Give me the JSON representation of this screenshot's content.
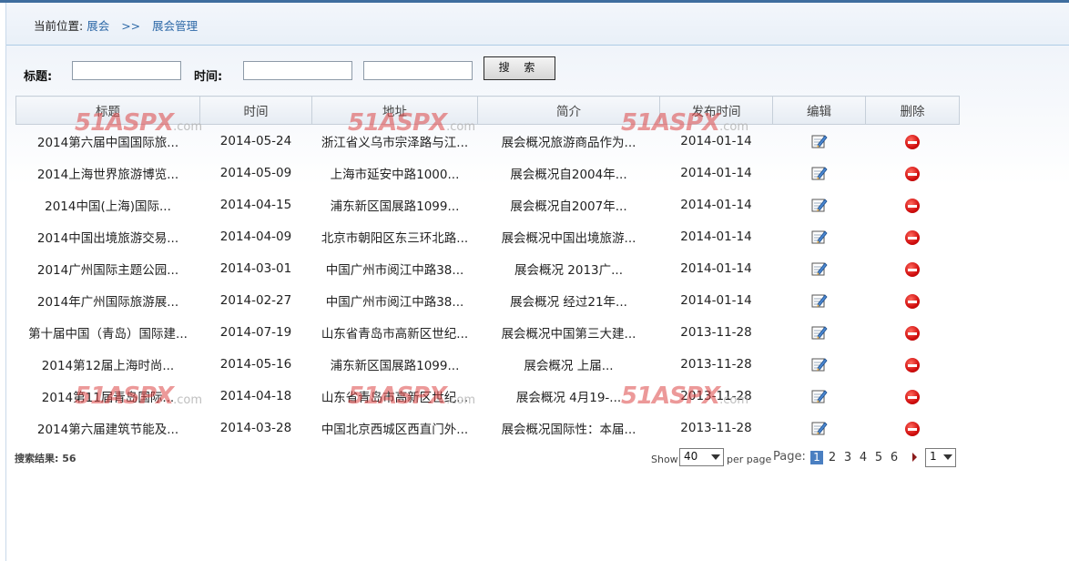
{
  "breadcrumb": {
    "prefix": "当前位置:",
    "link1": "展会",
    "sep": ">>",
    "link2": "展会管理"
  },
  "search": {
    "title_label": "标题:",
    "title_value": "",
    "time_label": "时间:",
    "time_from": "",
    "time_to": "",
    "button_label": "搜 索"
  },
  "table": {
    "headers": [
      "标题",
      "时间",
      "地址",
      "简介",
      "发布时间",
      "编辑",
      "删除"
    ],
    "rows": [
      [
        "2014第六届中国国际旅...",
        "2014-05-24",
        "浙江省义乌市宗泽路与江...",
        "展会概况旅游商品作为...",
        "2014-01-14"
      ],
      [
        "2014上海世界旅游博览...",
        "2014-05-09",
        "上海市延安中路1000...",
        "展会概况自2004年...",
        "2014-01-14"
      ],
      [
        "2014中国(上海)国际...",
        "2014-04-15",
        "浦东新区国展路1099...",
        "展会概况自2007年...",
        "2014-01-14"
      ],
      [
        "2014中国出境旅游交易...",
        "2014-04-09",
        "北京市朝阳区东三环北路...",
        "展会概况中国出境旅游...",
        "2014-01-14"
      ],
      [
        "2014广州国际主题公园...",
        "2014-03-01",
        "中国广州市阅江中路38...",
        "展会概况 2013广...",
        "2014-01-14"
      ],
      [
        "2014年广州国际旅游展...",
        "2014-02-27",
        "中国广州市阅江中路38...",
        "展会概况 经过21年...",
        "2014-01-14"
      ],
      [
        "第十届中国（青岛）国际建...",
        "2014-07-19",
        "山东省青岛市高新区世纪...",
        "展会概况中国第三大建...",
        "2013-11-28"
      ],
      [
        "2014第12届上海时尚...",
        "2014-05-16",
        "浦东新区国展路1099...",
        "展会概况 上届...",
        "2013-11-28"
      ],
      [
        "2014第11届青岛国际...",
        "2014-04-18",
        "山东省青岛市高新区世纪...",
        "展会概况 4月19-...",
        "2013-11-28"
      ],
      [
        "2014第六届建筑节能及...",
        "2014-03-28",
        "中国北京西城区西直门外...",
        "展会概况国际性：本届...",
        "2013-11-28"
      ]
    ]
  },
  "icons": {
    "edit": "edit-pencil-icon",
    "delete": "delete-minus-icon",
    "delete_color": "#d10e0e"
  },
  "watermark": {
    "brand": "51ASPX",
    "suffix": ".com"
  },
  "footer": {
    "total_label": "搜索结果: 56",
    "show_label": "Show",
    "page_size": "40",
    "per_page_label": "per page",
    "page_label": "Page:",
    "pages": [
      "1",
      "2",
      "3",
      "4",
      "5",
      "6"
    ],
    "current_page": "1",
    "page_select": "1"
  },
  "colors": {
    "accent": "#2f6aa8",
    "top_bar": "#3f6d9e",
    "current_page_bg": "#4a7fc1"
  }
}
